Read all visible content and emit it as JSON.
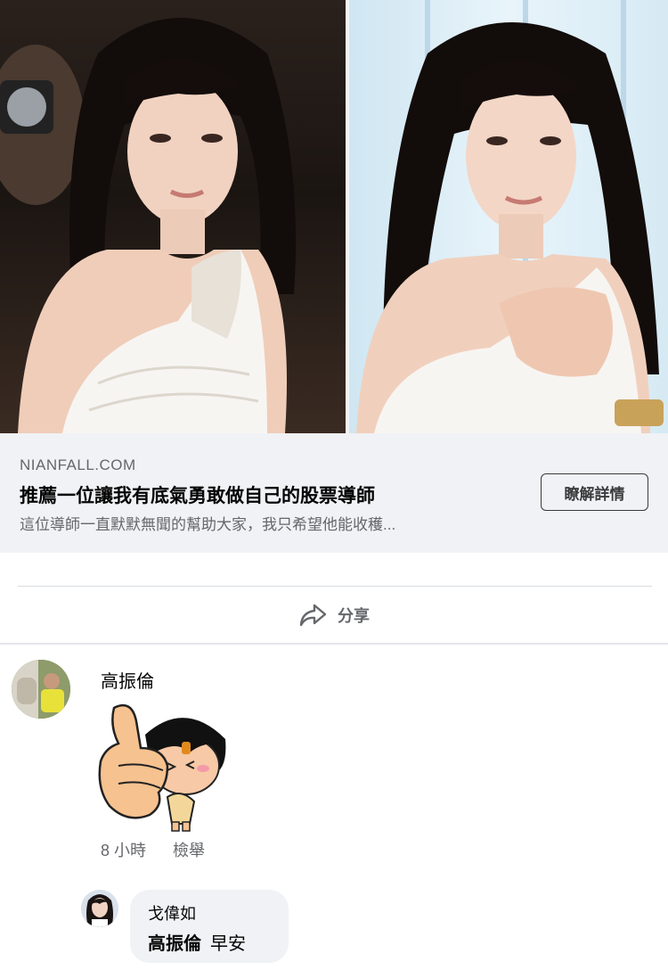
{
  "ad": {
    "domain": "NIANFALL.COM",
    "headline": "推薦一位讓我有底氣勇敢做自己的股票導師",
    "description": "這位導師一直默默無聞的幫助大家，我只希望他能收穫...",
    "cta_label": "瞭解詳情",
    "images": [
      "photo-left",
      "photo-right"
    ]
  },
  "actions": {
    "share_label": "分享",
    "share_icon": "share-arrow-icon"
  },
  "comments": [
    {
      "author": "高振倫",
      "content_type": "sticker",
      "sticker_icon": "thumbs-up-girl-sticker",
      "time": "8 小時",
      "report_label": "檢舉"
    }
  ],
  "reply": {
    "author": "戈偉如",
    "mention": "高振倫",
    "text": "早安"
  },
  "colors": {
    "link_preview_bg": "#f0f2f5",
    "secondary_text": "#65676b",
    "primary_text": "#050505"
  }
}
